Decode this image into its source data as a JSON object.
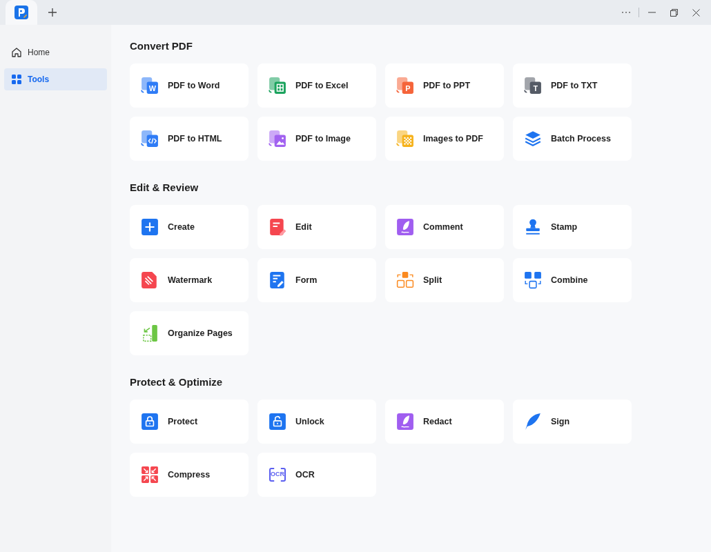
{
  "sidebar": {
    "items": [
      {
        "label": "Home",
        "kind": "house",
        "selected": false
      },
      {
        "label": "Tools",
        "kind": "grid",
        "selected": true
      }
    ]
  },
  "sections": [
    {
      "title": "Convert PDF",
      "tools": [
        {
          "label": "PDF to Word",
          "kind": "doc-word",
          "icon_text": "W"
        },
        {
          "label": "PDF to Excel",
          "kind": "doc-excel"
        },
        {
          "label": "PDF to PPT",
          "kind": "doc-ppt",
          "icon_text": "P"
        },
        {
          "label": "PDF to TXT",
          "kind": "doc-txt",
          "icon_text": "T"
        },
        {
          "label": "PDF to HTML",
          "kind": "doc-html"
        },
        {
          "label": "PDF to Image",
          "kind": "doc-image"
        },
        {
          "label": "Images to PDF",
          "kind": "doc-checker"
        },
        {
          "label": "Batch Process",
          "kind": "layers"
        }
      ]
    },
    {
      "title": "Edit & Review",
      "tools": [
        {
          "label": "Create",
          "kind": "plus"
        },
        {
          "label": "Edit",
          "kind": "note-pen"
        },
        {
          "label": "Comment",
          "kind": "quill"
        },
        {
          "label": "Stamp",
          "kind": "stamp"
        },
        {
          "label": "Watermark",
          "kind": "striped"
        },
        {
          "label": "Form",
          "kind": "form"
        },
        {
          "label": "Split",
          "kind": "split"
        },
        {
          "label": "Combine",
          "kind": "combine"
        },
        {
          "label": "Organize Pages",
          "kind": "organize"
        }
      ]
    },
    {
      "title": "Protect & Optimize",
      "tools": [
        {
          "label": "Protect",
          "kind": "lock"
        },
        {
          "label": "Unlock",
          "kind": "unlock"
        },
        {
          "label": "Redact",
          "kind": "quill"
        },
        {
          "label": "Sign",
          "kind": "feather"
        },
        {
          "label": "Compress",
          "kind": "compress"
        },
        {
          "label": "OCR",
          "kind": "ocr",
          "icon_text": "OCR"
        }
      ]
    }
  ]
}
